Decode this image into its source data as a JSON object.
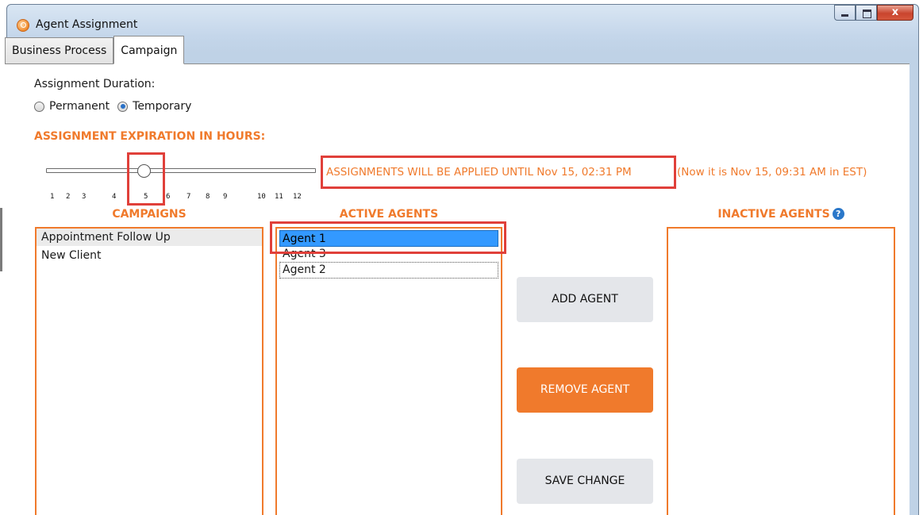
{
  "window": {
    "title": "Agent Assignment",
    "close_glyph": "x"
  },
  "tabs": [
    {
      "label": "Business Process",
      "active": false
    },
    {
      "label": "Campaign",
      "active": true
    }
  ],
  "assignment": {
    "duration_label": "Assignment Duration:",
    "options": [
      {
        "label": "Permanent",
        "checked": false
      },
      {
        "label": "Temporary",
        "checked": true
      }
    ],
    "expiration_heading": "ASSIGNMENT EXPIRATION IN HOURS:",
    "slider": {
      "min": 1,
      "max": 12,
      "value": 5,
      "ticks": [
        "1",
        "2",
        "3",
        "4",
        "5",
        "6",
        "7",
        "8",
        "9",
        "10",
        "11",
        "12"
      ]
    },
    "until_text": "ASSIGNMENTS WILL BE APPLIED UNTIL Nov 15, 02:31 PM",
    "now_text": "(Now it is Nov 15, 09:31 AM in EST)"
  },
  "campaigns": {
    "heading": "CAMPAIGNS",
    "items": [
      "Appointment Follow Up",
      "New Client"
    ]
  },
  "active_agents": {
    "heading": "ACTIVE AGENTS",
    "items": [
      "Agent 1",
      "Agent 3",
      "Agent 2"
    ]
  },
  "inactive_agents": {
    "heading": "INACTIVE AGENTS",
    "help_glyph": "?",
    "items": []
  },
  "actions": {
    "add": "ADD AGENT",
    "remove": "REMOVE AGENT",
    "save": "SAVE CHANGE"
  },
  "colors": {
    "accent": "#f07a2c",
    "selection": "#3399ff",
    "highlight": "#e0403a",
    "help": "#2a77c9"
  }
}
